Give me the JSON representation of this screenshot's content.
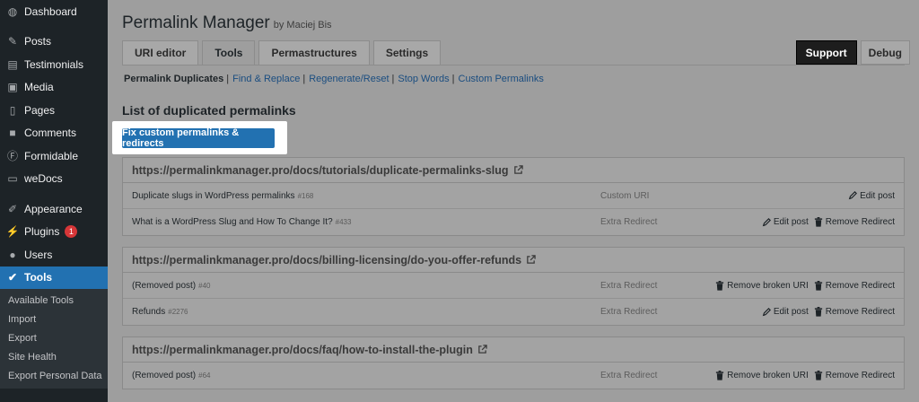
{
  "sidebar": {
    "items": [
      {
        "label": "Dashboard",
        "icon": "dashboard-icon",
        "glyph": "◍"
      },
      {
        "label": "Posts",
        "icon": "pin-icon",
        "glyph": "✎",
        "sep": true
      },
      {
        "label": "Testimonials",
        "icon": "testimonials-icon",
        "glyph": "▤"
      },
      {
        "label": "Media",
        "icon": "media-icon",
        "glyph": "▣"
      },
      {
        "label": "Pages",
        "icon": "pages-icon",
        "glyph": "▯"
      },
      {
        "label": "Comments",
        "icon": "comments-icon",
        "glyph": "■"
      },
      {
        "label": "Formidable",
        "icon": "formidable-icon",
        "glyph": "Ⓕ"
      },
      {
        "label": "weDocs",
        "icon": "docs-icon",
        "glyph": "▭"
      },
      {
        "label": "Appearance",
        "icon": "appearance-icon",
        "glyph": "✐",
        "sep": true
      },
      {
        "label": "Plugins",
        "icon": "plugins-icon",
        "glyph": "⚡",
        "badge": "1"
      },
      {
        "label": "Users",
        "icon": "users-icon",
        "glyph": "●"
      },
      {
        "label": "Tools",
        "icon": "tools-icon",
        "glyph": "✔",
        "active": true
      }
    ],
    "submenu": [
      "Available Tools",
      "Import",
      "Export",
      "Site Health",
      "Export Personal Data"
    ]
  },
  "header": {
    "title": "Permalink Manager",
    "byline": "by Maciej Bis"
  },
  "tabs": [
    "URI editor",
    "Tools",
    "Permastructures",
    "Settings"
  ],
  "right_buttons": {
    "support": "Support",
    "debug": "Debug"
  },
  "subnav": {
    "current": "Permalink Duplicates",
    "links": [
      "Find & Replace",
      "Regenerate/Reset",
      "Stop Words",
      "Custom Permalinks"
    ]
  },
  "section_title": "List of duplicated permalinks",
  "fix_button": "Fix custom permalinks & redirects",
  "groups": [
    {
      "url": "https://permalinkmanager.pro/docs/tutorials/duplicate-permalinks-slug",
      "rows": [
        {
          "title": "Duplicate slugs in WordPress permalinks",
          "id": "#168",
          "type": "Custom URI",
          "actions": [
            "Edit post"
          ]
        },
        {
          "title": "What is a WordPress Slug and How To Change It?",
          "id": "#433",
          "type": "Extra Redirect",
          "actions": [
            "Edit post",
            "Remove Redirect"
          ]
        }
      ]
    },
    {
      "url": "https://permalinkmanager.pro/docs/billing-licensing/do-you-offer-refunds",
      "rows": [
        {
          "title": "(Removed post)",
          "id": "#40",
          "type": "Extra Redirect",
          "actions": [
            "Remove broken URI",
            "Remove Redirect"
          ]
        },
        {
          "title": "Refunds",
          "id": "#2276",
          "type": "Extra Redirect",
          "actions": [
            "Edit post",
            "Remove Redirect"
          ]
        }
      ]
    },
    {
      "url": "https://permalinkmanager.pro/docs/faq/how-to-install-the-plugin",
      "rows": [
        {
          "title": "(Removed post)",
          "id": "#64",
          "type": "Extra Redirect",
          "actions": [
            "Remove broken URI",
            "Remove Redirect"
          ]
        }
      ]
    }
  ],
  "colors": {
    "accent": "#2271b1",
    "sidebar_bg": "#1d2327",
    "badge": "#d63638"
  }
}
